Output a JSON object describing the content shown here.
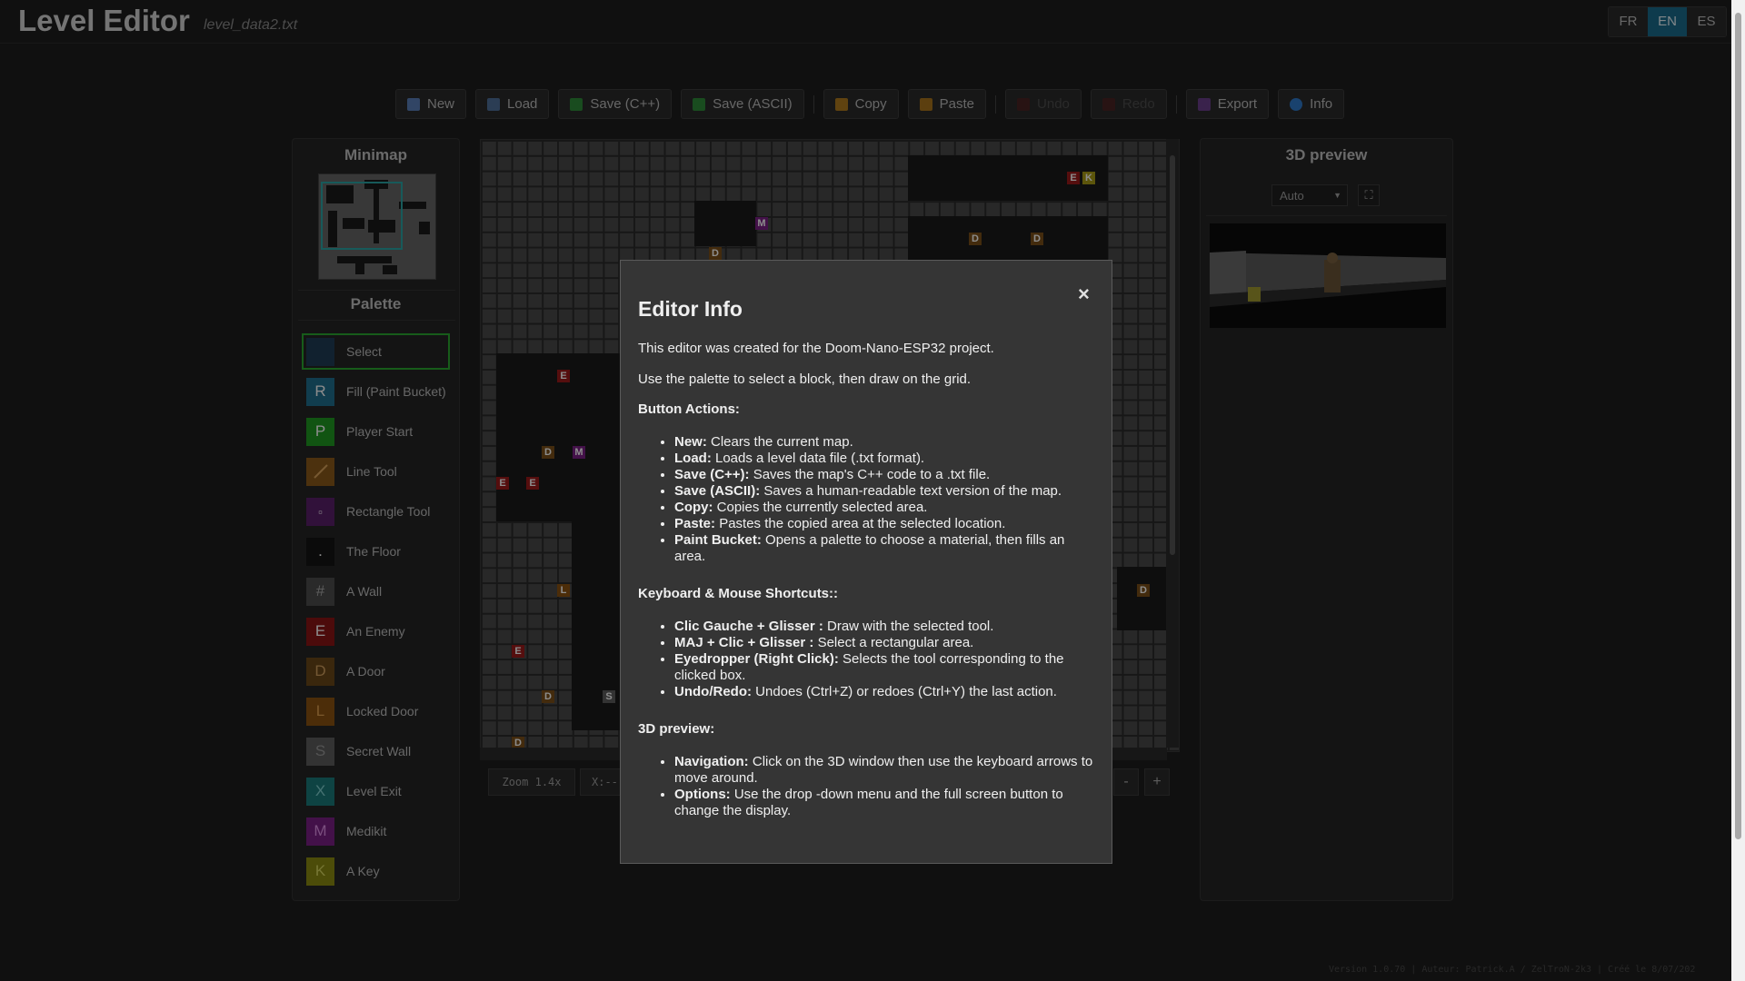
{
  "header": {
    "title": "Level Editor",
    "file_name": "level_data2.txt",
    "languages": [
      "FR",
      "EN",
      "ES"
    ],
    "active_language": "EN"
  },
  "toolbar": {
    "new": "New",
    "load": "Load",
    "save_cpp": "Save (C++)",
    "save_ascii": "Save (ASCII)",
    "copy": "Copy",
    "paste": "Paste",
    "undo": "Undo",
    "redo": "Redo",
    "export": "Export",
    "info": "Info"
  },
  "left_panel": {
    "minimap_title": "Minimap",
    "palette_title": "Palette",
    "palette": [
      {
        "glyph": "",
        "label": "Select",
        "color": "#1f3d57"
      },
      {
        "glyph": "R",
        "label": "Fill (Paint Bucket)",
        "color": "#1f6f8f"
      },
      {
        "glyph": "P",
        "label": "Player Start",
        "color": "#1f9a22"
      },
      {
        "glyph": "",
        "label": "Line Tool",
        "color": "#8a5a1a"
      },
      {
        "glyph": "▫",
        "label": "Rectangle Tool",
        "color": "#5a1f6a"
      },
      {
        "glyph": ".",
        "label": "The Floor",
        "color": "#141414"
      },
      {
        "glyph": "#",
        "label": "A Wall",
        "color": "#4d4d4d"
      },
      {
        "glyph": "E",
        "label": "An Enemy",
        "color": "#8b1515"
      },
      {
        "glyph": "D",
        "label": "A Door",
        "color": "#6b4719"
      },
      {
        "glyph": "L",
        "label": "Locked Door",
        "color": "#8a5212"
      },
      {
        "glyph": "S",
        "label": "Secret Wall",
        "color": "#5e5e5e"
      },
      {
        "glyph": "X",
        "label": "Level Exit",
        "color": "#1b7a7a"
      },
      {
        "glyph": "M",
        "label": "Medikit",
        "color": "#7a1f86"
      },
      {
        "glyph": "K",
        "label": "A Key",
        "color": "#8b8b12"
      }
    ]
  },
  "grid": {
    "zoom_label": "Zoom 1.4x",
    "coords": "X:--",
    "markers": [
      "E",
      "K",
      "M",
      "D",
      "D",
      "D",
      "E",
      "D",
      "M",
      "E",
      "E",
      "L",
      "E",
      "D",
      "S",
      "D",
      "D"
    ]
  },
  "right_panel": {
    "title": "3D preview",
    "view_mode": "Auto"
  },
  "footer": {
    "version": "Version 1.0.70 | Auteur: Patrick.A / ZelTroN-2k3 | Créé le 8/07/202"
  },
  "modal": {
    "title": "Editor Info",
    "close": "×",
    "intro1": "This editor was created for the Doom-Nano-ESP32 project.",
    "intro2": "Use the palette to select a block, then draw on the grid.",
    "buttons_heading": "Button Actions:",
    "buttons": [
      {
        "term": "New:",
        "desc": " Clears the current map."
      },
      {
        "term": "Load:",
        "desc": " Loads a level data file (.txt format)."
      },
      {
        "term": "Save (C++):",
        "desc": " Saves the map's C++ code to a .txt file."
      },
      {
        "term": "Save (ASCII):",
        "desc": " Saves a human-readable text version of the map."
      },
      {
        "term": "Copy:",
        "desc": " Copies the currently selected area."
      },
      {
        "term": "Paste:",
        "desc": " Pastes the copied area at the selected location."
      },
      {
        "term": "Paint Bucket:",
        "desc": " Opens a palette to choose a material, then fills an area."
      }
    ],
    "shortcuts_heading": "Keyboard & Mouse Shortcuts::",
    "shortcuts": [
      {
        "term": "Clic Gauche + Glisser :",
        "desc": " Draw with the selected tool."
      },
      {
        "term": "MAJ + Clic + Glisser :",
        "desc": " Select a rectangular area."
      },
      {
        "term": "Eyedropper (Right Click):",
        "desc": " Selects the tool corresponding to the clicked box."
      },
      {
        "term": "Undo/Redo:",
        "desc": " Undoes (Ctrl+Z) or redoes (Ctrl+Y) the last action."
      }
    ],
    "preview_heading": "3D preview:",
    "preview": [
      {
        "term": "Navigation:",
        "desc": " Click on the 3D window then use the keyboard arrows to move around."
      },
      {
        "term": "Options:",
        "desc": " Use the drop -down menu and the full screen button to change the display."
      }
    ]
  }
}
